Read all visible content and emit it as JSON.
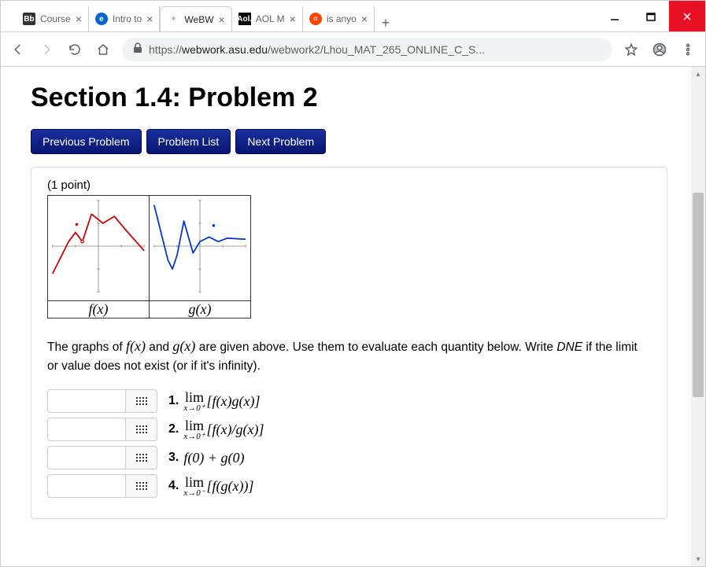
{
  "tabs": [
    {
      "title": "Course",
      "icon": "bb"
    },
    {
      "title": "Intro to",
      "icon": "e"
    },
    {
      "title": "WeBW",
      "icon": "star",
      "active": true
    },
    {
      "title": "AOL M",
      "icon": "aol"
    },
    {
      "title": "is anyo",
      "icon": "reddit"
    }
  ],
  "url": {
    "scheme": "https://",
    "host": "webwork.asu.edu",
    "path": "/webwork2/Lhou_MAT_265_ONLINE_C_S..."
  },
  "page": {
    "title": "Section 1.4: Problem 2",
    "nav": {
      "prev": "Previous Problem",
      "list": "Problem List",
      "next": "Next Problem"
    },
    "points": "(1 point)",
    "graph_labels": {
      "f": "f(x)",
      "g": "g(x)"
    },
    "instructions_pre": "The graphs of ",
    "instructions_mid1": " and ",
    "instructions_mid2": " are given above. Use them to evaluate each quantity below. Write ",
    "instructions_dne": "DNE",
    "instructions_post": " if the limit or value does not exist (or if it's infinity).",
    "questions": [
      {
        "num": "1.",
        "lim": "lim",
        "limsub": "x→0⁺",
        "expr": "[f(x)g(x)]"
      },
      {
        "num": "2.",
        "lim": "lim",
        "limsub": "x→0⁺",
        "expr": "[f(x)/g(x)]"
      },
      {
        "num": "3.",
        "lim": "",
        "limsub": "",
        "expr": "f(0) + g(0)"
      },
      {
        "num": "4.",
        "lim": "lim",
        "limsub": "x→0⁻",
        "expr": "[f(g(x))]"
      }
    ]
  },
  "chart_data": [
    {
      "type": "line",
      "title": "f(x)",
      "xlim": [
        -2,
        2
      ],
      "ylim": [
        -2,
        2
      ],
      "series": [
        {
          "name": "f",
          "color": "#cc0000",
          "points": [
            [
              -2,
              -1.2
            ],
            [
              -1.3,
              0.2
            ],
            [
              -1,
              0.6
            ],
            [
              -0.7,
              0.2
            ],
            [
              -0.3,
              1.4
            ],
            [
              0.2,
              1.0
            ],
            [
              0.7,
              1.3
            ],
            [
              1.2,
              0.7
            ],
            [
              2,
              -0.2
            ]
          ]
        }
      ],
      "open_points": [
        {
          "x": -0.7,
          "y": 0.2
        }
      ],
      "closed_points": [
        {
          "x": -0.95,
          "y": 0.95
        }
      ]
    },
    {
      "type": "line",
      "title": "g(x)",
      "xlim": [
        -2,
        2
      ],
      "ylim": [
        -2,
        2
      ],
      "series": [
        {
          "name": "g",
          "color": "#0033cc",
          "points": [
            [
              -2,
              1.8
            ],
            [
              -1.4,
              -0.6
            ],
            [
              -1.2,
              -1.0
            ],
            [
              -1,
              -0.4
            ],
            [
              -0.7,
              1.1
            ],
            [
              -0.3,
              -0.3
            ],
            [
              0,
              0.2
            ],
            [
              0.4,
              0.4
            ],
            [
              0.8,
              0.2
            ],
            [
              1.2,
              0.35
            ],
            [
              2,
              0.3
            ]
          ]
        }
      ],
      "closed_points": [
        {
          "x": 0.6,
          "y": 0.9
        }
      ]
    }
  ]
}
